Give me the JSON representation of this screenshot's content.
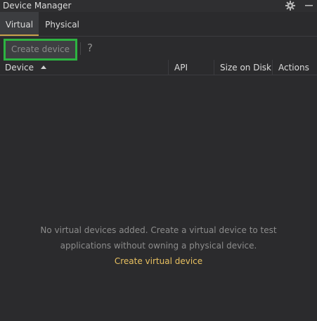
{
  "window": {
    "title": "Device Manager"
  },
  "tabs": [
    {
      "label": "Virtual",
      "selected": true
    },
    {
      "label": "Physical",
      "selected": false
    }
  ],
  "toolbar": {
    "create_label": "Create device",
    "help_label": "?"
  },
  "table": {
    "columns": [
      {
        "label": "Device",
        "sorted": "ascending"
      },
      {
        "label": "API"
      },
      {
        "label": "Size on Disk"
      },
      {
        "label": "Actions"
      }
    ],
    "rows": []
  },
  "empty_state": {
    "line1": "No virtual devices added. Create a virtual device to test",
    "line2": "applications without owning a physical device.",
    "link": "Create virtual device"
  },
  "colors": {
    "background": "#2b2b2d",
    "accent_tab": "#c7a04a",
    "link": "#e8c060",
    "highlight_outline": "#2db341"
  },
  "icons": {
    "settings": "gear-icon",
    "minimize": "minimize-icon",
    "sort": "sort-ascending-icon",
    "help": "question-mark-icon"
  }
}
